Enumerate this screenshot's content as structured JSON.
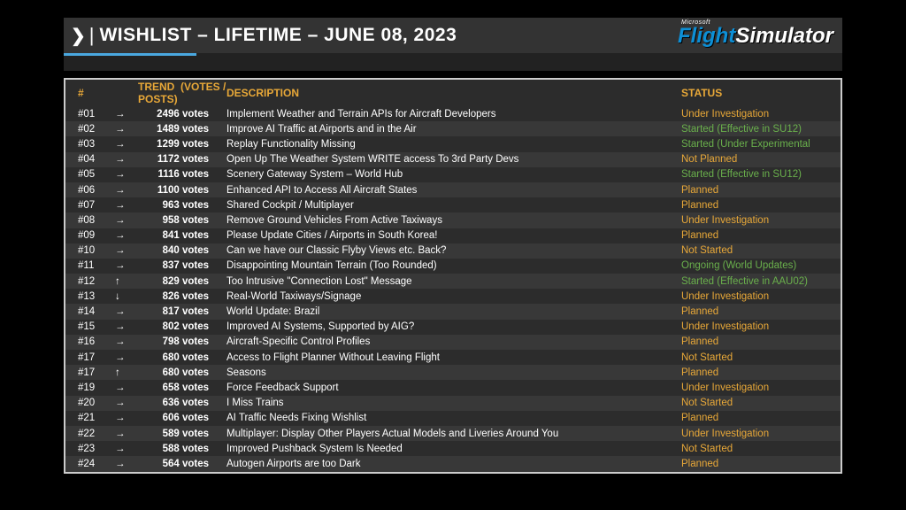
{
  "header": {
    "title": "WISHLIST – LIFETIME – JUNE 08, 2023",
    "logo_small": "Microsoft",
    "logo_flight": "Flight",
    "logo_sim": "Simulator"
  },
  "columns": {
    "rank": "#",
    "trend": "TREND",
    "votes": "(VOTES / POSTS)",
    "description": "DESCRIPTION",
    "status": "STATUS"
  },
  "rows": [
    {
      "rank": "#01",
      "trend": "→",
      "votes": "2496 votes",
      "desc": "Implement Weather and Terrain APIs for Aircraft Developers",
      "status": "Under Investigation",
      "sc": "yellow"
    },
    {
      "rank": "#02",
      "trend": "→",
      "votes": "1489 votes",
      "desc": "Improve AI Traffic at Airports and in the Air",
      "status": "Started (Effective in SU12)",
      "sc": "green"
    },
    {
      "rank": "#03",
      "trend": "→",
      "votes": "1299 votes",
      "desc": "Replay Functionality Missing",
      "status": "Started (Under Experimental",
      "sc": "green"
    },
    {
      "rank": "#04",
      "trend": "→",
      "votes": "1172 votes",
      "desc": "Open Up The Weather System WRITE access To 3rd Party Devs",
      "status": "Not Planned",
      "sc": "yellow"
    },
    {
      "rank": "#05",
      "trend": "→",
      "votes": "1116 votes",
      "desc": "Scenery Gateway System – World Hub",
      "status": "Started (Effective in SU12)",
      "sc": "green"
    },
    {
      "rank": "#06",
      "trend": "→",
      "votes": "1100 votes",
      "desc": "Enhanced API to Access All Aircraft States",
      "status": "Planned",
      "sc": "yellow"
    },
    {
      "rank": "#07",
      "trend": "→",
      "votes": "963 votes",
      "desc": "Shared Cockpit / Multiplayer",
      "status": "Planned",
      "sc": "yellow"
    },
    {
      "rank": "#08",
      "trend": "→",
      "votes": "958 votes",
      "desc": "Remove Ground Vehicles From Active Taxiways",
      "status": "Under Investigation",
      "sc": "yellow"
    },
    {
      "rank": "#09",
      "trend": "→",
      "votes": "841 votes",
      "desc": "Please Update Cities / Airports in South Korea!",
      "status": "Planned",
      "sc": "yellow"
    },
    {
      "rank": "#10",
      "trend": "→",
      "votes": "840 votes",
      "desc": "Can we have our Classic Flyby Views etc. Back?",
      "status": "Not Started",
      "sc": "yellow"
    },
    {
      "rank": "#11",
      "trend": "→",
      "votes": "837 votes",
      "desc": "Disappointing Mountain Terrain (Too Rounded)",
      "status": "Ongoing (World Updates)",
      "sc": "green"
    },
    {
      "rank": "#12",
      "trend": "↑",
      "votes": "829 votes",
      "desc": "Too Intrusive \"Connection Lost\" Message",
      "status": "Started (Effective in AAU02)",
      "sc": "green"
    },
    {
      "rank": "#13",
      "trend": "↓",
      "votes": "826 votes",
      "desc": "Real-World Taxiways/Signage",
      "status": "Under Investigation",
      "sc": "yellow"
    },
    {
      "rank": "#14",
      "trend": "→",
      "votes": "817 votes",
      "desc": "World Update: Brazil",
      "status": "Planned",
      "sc": "yellow"
    },
    {
      "rank": "#15",
      "trend": "→",
      "votes": "802 votes",
      "desc": "Improved AI Systems, Supported by AIG?",
      "status": "Under Investigation",
      "sc": "yellow"
    },
    {
      "rank": "#16",
      "trend": "→",
      "votes": "798 votes",
      "desc": "Aircraft-Specific Control Profiles",
      "status": "Planned",
      "sc": "yellow"
    },
    {
      "rank": "#17",
      "trend": "→",
      "votes": "680 votes",
      "desc": "Access to Flight Planner Without Leaving Flight",
      "status": "Not Started",
      "sc": "yellow"
    },
    {
      "rank": "#17",
      "trend": "↑",
      "votes": "680 votes",
      "desc": "Seasons",
      "status": "Planned",
      "sc": "yellow"
    },
    {
      "rank": "#19",
      "trend": "→",
      "votes": "658 votes",
      "desc": "Force Feedback Support",
      "status": "Under Investigation",
      "sc": "yellow"
    },
    {
      "rank": "#20",
      "trend": "→",
      "votes": "636 votes",
      "desc": "I Miss Trains",
      "status": "Not Started",
      "sc": "yellow"
    },
    {
      "rank": "#21",
      "trend": "→",
      "votes": "606 votes",
      "desc": "AI Traffic Needs Fixing Wishlist",
      "status": "Planned",
      "sc": "yellow"
    },
    {
      "rank": "#22",
      "trend": "→",
      "votes": "589 votes",
      "desc": "Multiplayer: Display Other Players Actual Models and Liveries Around You",
      "status": "Under Investigation",
      "sc": "yellow"
    },
    {
      "rank": "#23",
      "trend": "→",
      "votes": "588 votes",
      "desc": "Improved Pushback System Is Needed",
      "status": "Not Started",
      "sc": "yellow"
    },
    {
      "rank": "#24",
      "trend": "→",
      "votes": "564 votes",
      "desc": "Autogen Airports are too Dark",
      "status": "Planned",
      "sc": "yellow"
    }
  ]
}
